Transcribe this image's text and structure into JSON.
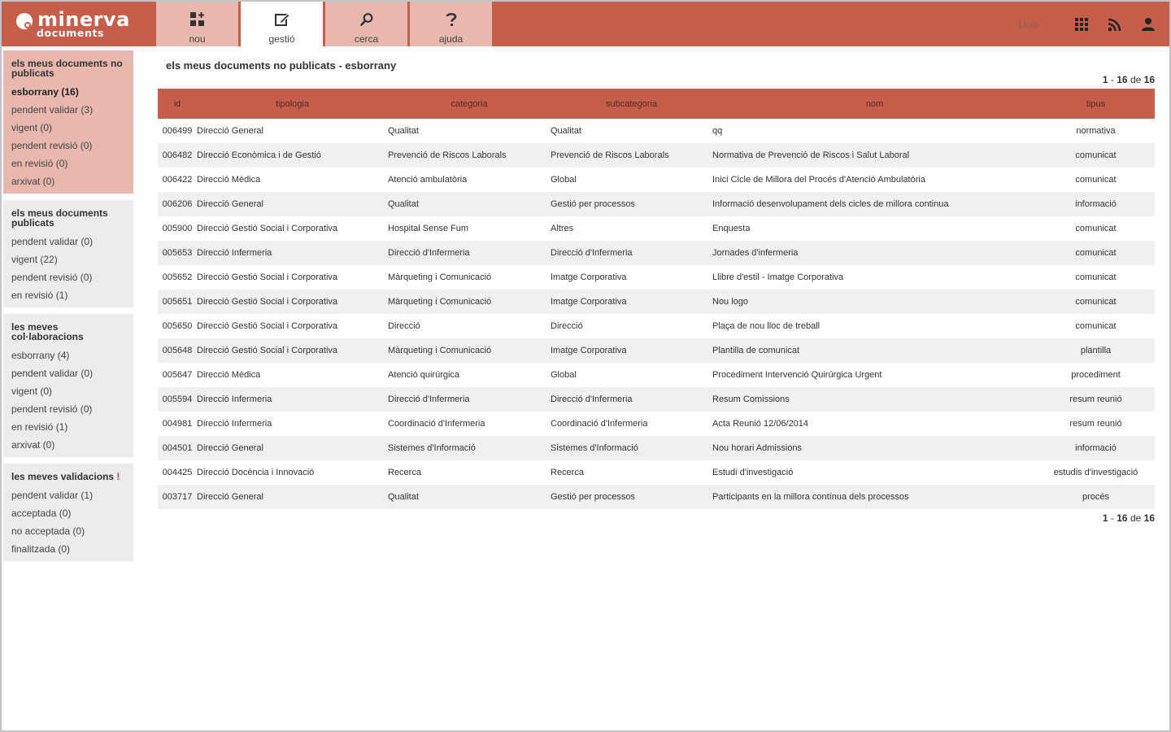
{
  "brand": {
    "name": "minerva",
    "sub": "documents"
  },
  "nav": [
    {
      "label": "nou",
      "icon": "new-icon",
      "active": false
    },
    {
      "label": "gestió",
      "icon": "edit-icon",
      "active": true
    },
    {
      "label": "cerca",
      "icon": "search-icon",
      "active": false
    },
    {
      "label": "ajuda",
      "icon": "help-icon",
      "active": false
    }
  ],
  "user": {
    "name": "Lluis"
  },
  "sidebar": {
    "unpublished": {
      "title": "els meus documents no publicats",
      "items": [
        {
          "label": "esborrany (16)"
        },
        {
          "label": "pendent validar (3)"
        },
        {
          "label": "vigent (0)"
        },
        {
          "label": "pendent revisió (0)"
        },
        {
          "label": "en revisió (0)"
        },
        {
          "label": "arxivat (0)"
        }
      ]
    },
    "published": {
      "title": "els meus documents publicats",
      "items": [
        {
          "label": "pendent validar (0)"
        },
        {
          "label": "vigent (22)"
        },
        {
          "label": "pendent revisió (0)"
        },
        {
          "label": "en revisió (1)"
        }
      ]
    },
    "collab": {
      "title": "les meves col·laboracions",
      "items": [
        {
          "label": "esborrany (4)"
        },
        {
          "label": "pendent validar (0)"
        },
        {
          "label": "vigent (0)"
        },
        {
          "label": "pendent revisió (0)"
        },
        {
          "label": "en revisió (1)"
        },
        {
          "label": "arxivat (0)"
        }
      ]
    },
    "validations": {
      "title": "les meves validacions",
      "alert": "!",
      "items": [
        {
          "label": "pendent validar (1)"
        },
        {
          "label": "acceptada (0)"
        },
        {
          "label": "no acceptada (0)"
        },
        {
          "label": "finalitzada (0)"
        }
      ]
    }
  },
  "main": {
    "title": "els meus documents no publicats - esborrany",
    "pager": {
      "from": "1",
      "to": "16",
      "of_word": "de",
      "total": "16"
    },
    "columns": [
      "id",
      "tipologia",
      "categoria",
      "subcategoria",
      "nom",
      "tipus"
    ],
    "rows": [
      [
        "006499",
        "Direcció General",
        "Qualitat",
        "Qualitat",
        "qq",
        "normativa"
      ],
      [
        "006482",
        "Direcció Econòmica i de Gestió",
        "Prevenció de Riscos Laborals",
        "Prevenció de Riscos Laborals",
        "Normativa de Prevenció de Riscos i Salut Laboral",
        "comunicat"
      ],
      [
        "006422",
        "Direcció Mèdica",
        "Atenció ambulatòria",
        "Global",
        "Inici Cicle de Millora del Procés d'Atenció Ambulatòria",
        "comunicat"
      ],
      [
        "006206",
        "Direcció General",
        "Qualitat",
        "Gestió per processos",
        "Informació desenvolupament dels cicles de millora continua",
        "informació"
      ],
      [
        "005900",
        "Direcció Gestió Social i Corporativa",
        "Hospital Sense Fum",
        "Altres",
        "Enquesta",
        "comunicat"
      ],
      [
        "005653",
        "Direcció Infermeria",
        "Direcció d'Infermeria",
        "Direcció d'Infermeria",
        "Jornades d'infermeria",
        "comunicat"
      ],
      [
        "005652",
        "Direcció Gestió Social i Corporativa",
        "Màrqueting i Comunicació",
        "Imatge Corporativa",
        "Llibre d'estil - Imatge Corporativa",
        "comunicat"
      ],
      [
        "005651",
        "Direcció Gestió Social i Corporativa",
        "Màrqueting i Comunicació",
        "Imatge Corporativa",
        "Nou logo",
        "comunicat"
      ],
      [
        "005650",
        "Direcció Gestió Social i Corporativa",
        "Direcció",
        "Direcció",
        "Plaça de nou lloc de treball",
        "comunicat"
      ],
      [
        "005648",
        "Direcció Gestió Social i Corporativa",
        "Màrqueting i Comunicació",
        "Imatge Corporativa",
        "Plantilla de comunicat",
        "plantilla"
      ],
      [
        "005647",
        "Direcció Mèdica",
        "Atenció quirúrgica",
        "Global",
        "Procediment Intervenció Quirúrgica Urgent",
        "procediment"
      ],
      [
        "005594",
        "Direcció Infermeria",
        "Direcció d'Infermeria",
        "Direcció d'Infermeria",
        "Resum Comissions",
        "resum reunió"
      ],
      [
        "004981",
        "Direcció Infermeria",
        "Coordinació d'Infermeria",
        "Coordinació d'Infermeria",
        "Acta Reunió 12/06/2014",
        "resum reunió"
      ],
      [
        "004501",
        "Direcció General",
        "Sistemes d'Informació",
        "Sistemes d'Informació",
        "Nou horari Admissions",
        "informació"
      ],
      [
        "004425",
        "Direcció Docència i Innovació",
        "Recerca",
        "Recerca",
        "Estudi d'investigació",
        "estudis d'investigació"
      ],
      [
        "003717",
        "Direcció General",
        "Qualitat",
        "Gestió per processos",
        "Participants en la millora contínua dels processos",
        "procés"
      ]
    ]
  },
  "colors": {
    "accent": "#c55e4a",
    "tab": "#e8b7ad",
    "sidebar": "#ececec"
  }
}
